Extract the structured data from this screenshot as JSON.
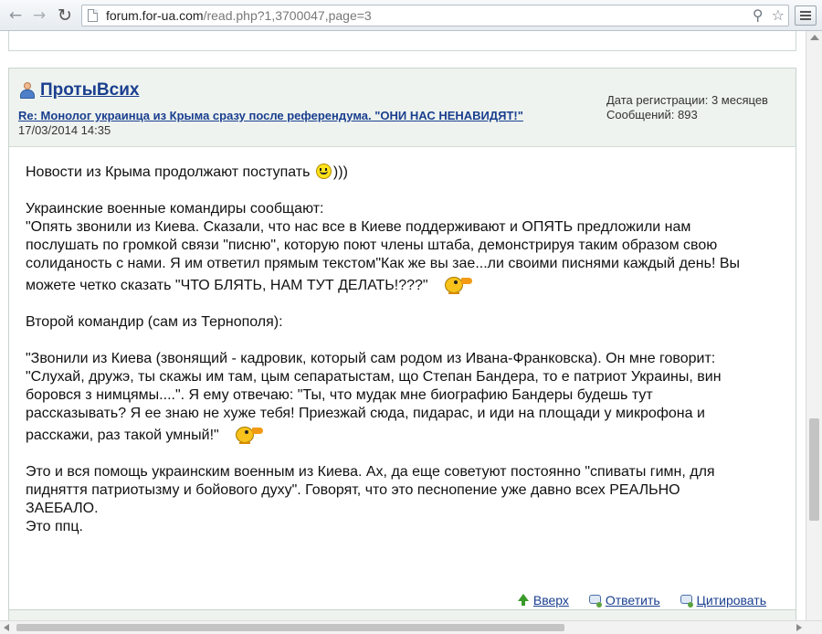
{
  "browser": {
    "url_host": "forum.for-ua.com",
    "url_path": "/read.php?1,3700047,page=3",
    "icons": {
      "back": "back-arrow-icon",
      "forward": "forward-arrow-icon",
      "reload": "reload-icon",
      "zoom": "magnifier-icon",
      "bookmark": "star-icon",
      "menu": "hamburger-menu-icon"
    }
  },
  "post": {
    "username": "ПротыВсих",
    "subject": "Re: Монолог украинца из Крыма сразу после референдума. \"ОНИ НАС НЕНАВИДЯТ!\"",
    "date": "17/03/2014 14:35",
    "registration": "Дата регистрации: 3 месяцев",
    "messages": "Сообщений: 893",
    "body": {
      "p1": "Новости из Крыма продолжают поступать",
      "p1_tail": ")))",
      "p2_l1": "Украинские военные командиры сообщают:",
      "p2_l2": "\"Опять звонили из Киева. Сказали, что нас все в Киеве поддерживают и ОПЯТЬ предложили нам",
      "p2_l3": "послушать по громкой связи \"писню\", которую поют члены штаба, демонстрируя таким образом свою",
      "p2_l4": "солиданость с нами. Я им ответил прямым текстом\"Как же вы зае...ли своими писнями каждый день! Вы",
      "p2_l5": "можете четко сказать \"ЧТО БЛЯТЬ, НАМ ТУТ ДЕЛАТЬ!???\"",
      "p3": "Второй командир (сам из Тернополя):",
      "p4_l1": "\"Звонили из Киева (звонящий - кадровик, который сам родом из Ивана-Франковска). Он мне говорит:",
      "p4_l2": "\"Слухай, дружэ, ты скажы им там, цым сепаратыстам, що Степан Бандера, то е патриот Украины, вин",
      "p4_l3": "боровся з нимцямы....\". Я ему отвечаю: \"Ты, что мудак мне биографию Бандеры будешь тут",
      "p4_l4": "рассказывать? Я ее знаю не хуже тебя! Приезжай сюда, пидарас, и иди на площади у микрофона и",
      "p4_l5": "расскажи, раз такой умный!\"",
      "p5_l1": "Это и вся помощь украинским военным из Киева. Ах, да еще советуют постоянно \"спиваты гимн, для",
      "p5_l2": "пидняття патриотызму и бойового духу\". Говорят, что это песнопение уже давно всех РЕАЛЬНО",
      "p5_l3": "ЗАЕБАЛО.",
      "p5_l4": "Это ппц."
    },
    "actions": {
      "up": "Вверх",
      "reply": "Ответить",
      "quote": "Цитировать"
    }
  },
  "colors": {
    "link": "#1a3f8f",
    "header_bg": "#eef3ef",
    "border": "#c9d4cf"
  }
}
